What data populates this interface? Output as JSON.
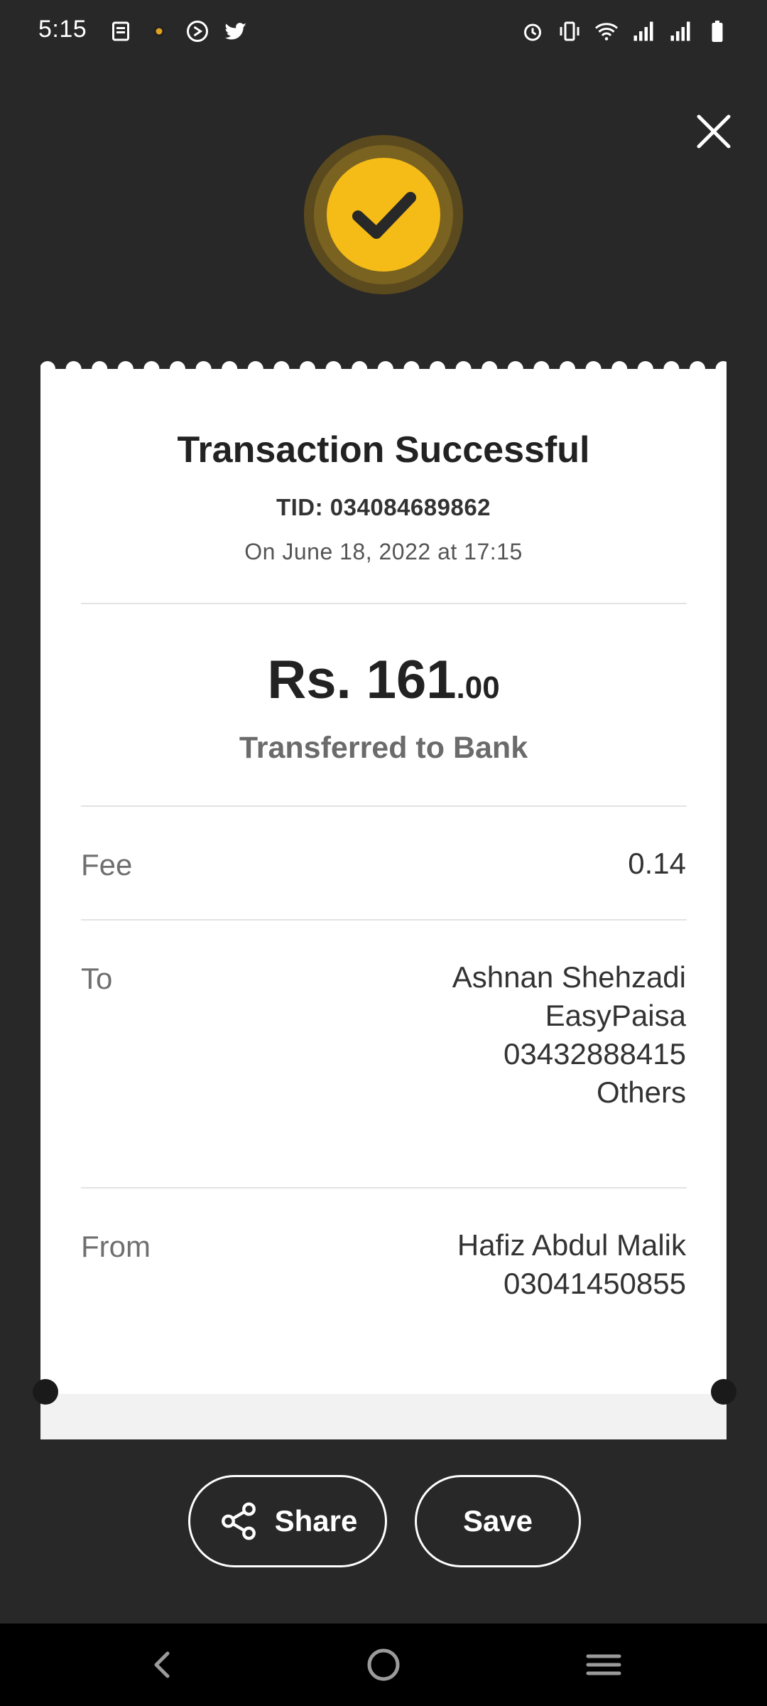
{
  "status_bar": {
    "time": "5:15",
    "left_icons": [
      "news-icon",
      "app-icon",
      "assistant-icon",
      "twitter-icon"
    ],
    "right_icons": [
      "alarm-icon",
      "vibrate-icon",
      "wifi-icon",
      "signal-icon",
      "signal-icon",
      "battery-icon"
    ]
  },
  "receipt": {
    "title": "Transaction Successful",
    "tid": "TID: 034084689862",
    "date": "On June 18, 2022 at 17:15",
    "amount_main": "Rs. 161",
    "amount_cents": ".00",
    "amount_subtitle": "Transferred to Bank",
    "fee_label": "Fee",
    "fee_value": "0.14",
    "to_label": "To",
    "to_lines": [
      "Ashnan Shehzadi",
      "EasyPaisa",
      "03432888415",
      "Others"
    ],
    "from_label": "From",
    "from_lines": [
      "Hafiz Abdul Malik",
      "03041450855"
    ]
  },
  "actions": {
    "share_label": "Share",
    "save_label": "Save"
  },
  "colors": {
    "background": "#282828",
    "accent": "#f5bb17",
    "receipt": "#ffffff"
  }
}
